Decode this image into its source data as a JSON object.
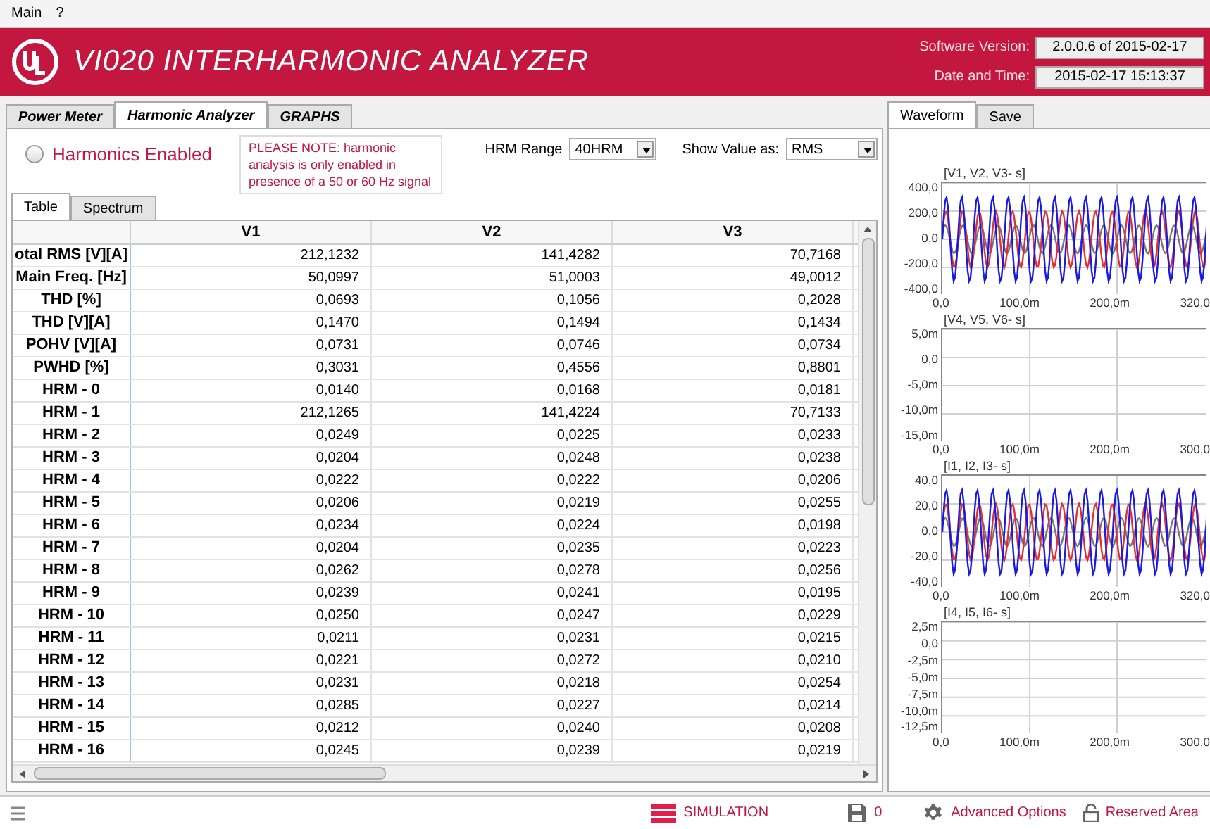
{
  "menu": [
    "Main",
    "?"
  ],
  "header": {
    "title": "VI020 INTERHARMONIC ANALYZER",
    "version_label": "Software Version:",
    "version": "2.0.0.6 of 2015-02-17",
    "datetime_label": "Date and Time:",
    "datetime": "2015-02-17 15:13:37"
  },
  "tabs": [
    {
      "label": "Power Meter",
      "selected": false
    },
    {
      "label": "Harmonic Analyzer",
      "selected": true
    },
    {
      "label": "GRAPHS",
      "selected": false
    }
  ],
  "harmonics": {
    "label": "Harmonics Enabled",
    "on": false
  },
  "note": "PLEASE NOTE: harmonic analysis is only enabled in presence of a 50 or 60 Hz signal",
  "hrm_range": {
    "label": "HRM Range",
    "value": "40HRM"
  },
  "show_value": {
    "label": "Show Value as:",
    "value": "RMS"
  },
  "subtabs": [
    {
      "label": "Table",
      "selected": true
    },
    {
      "label": "Spectrum",
      "selected": false
    }
  ],
  "table": {
    "columns": [
      "V1",
      "V2",
      "V3"
    ],
    "rows": [
      {
        "label": "otal RMS [V][A]",
        "values": [
          "212,1232",
          "141,4282",
          "70,7168"
        ]
      },
      {
        "label": "Main Freq. [Hz]",
        "values": [
          "50,0997",
          "51,0003",
          "49,0012"
        ]
      },
      {
        "label": "THD [%]",
        "values": [
          "0,0693",
          "0,1056",
          "0,2028"
        ]
      },
      {
        "label": "THD [V][A]",
        "values": [
          "0,1470",
          "0,1494",
          "0,1434"
        ]
      },
      {
        "label": "POHV [V][A]",
        "values": [
          "0,0731",
          "0,0746",
          "0,0734"
        ]
      },
      {
        "label": "PWHD [%]",
        "values": [
          "0,3031",
          "0,4556",
          "0,8801"
        ]
      },
      {
        "label": "HRM - 0",
        "values": [
          "0,0140",
          "0,0168",
          "0,0181"
        ]
      },
      {
        "label": "HRM - 1",
        "values": [
          "212,1265",
          "141,4224",
          "70,7133"
        ]
      },
      {
        "label": "HRM - 2",
        "values": [
          "0,0249",
          "0,0225",
          "0,0233"
        ]
      },
      {
        "label": "HRM - 3",
        "values": [
          "0,0204",
          "0,0248",
          "0,0238"
        ]
      },
      {
        "label": "HRM - 4",
        "values": [
          "0,0222",
          "0,0222",
          "0,0206"
        ]
      },
      {
        "label": "HRM - 5",
        "values": [
          "0,0206",
          "0,0219",
          "0,0255"
        ]
      },
      {
        "label": "HRM - 6",
        "values": [
          "0,0234",
          "0,0224",
          "0,0198"
        ]
      },
      {
        "label": "HRM - 7",
        "values": [
          "0,0204",
          "0,0235",
          "0,0223"
        ]
      },
      {
        "label": "HRM - 8",
        "values": [
          "0,0262",
          "0,0278",
          "0,0256"
        ]
      },
      {
        "label": "HRM - 9",
        "values": [
          "0,0239",
          "0,0241",
          "0,0195"
        ]
      },
      {
        "label": "HRM - 10",
        "values": [
          "0,0250",
          "0,0247",
          "0,0229"
        ]
      },
      {
        "label": "HRM - 11",
        "values": [
          "0,0211",
          "0,0231",
          "0,0215"
        ]
      },
      {
        "label": "HRM - 12",
        "values": [
          "0,0221",
          "0,0272",
          "0,0210"
        ]
      },
      {
        "label": "HRM - 13",
        "values": [
          "0,0231",
          "0,0218",
          "0,0254"
        ]
      },
      {
        "label": "HRM - 14",
        "values": [
          "0,0285",
          "0,0227",
          "0,0214"
        ]
      },
      {
        "label": "HRM - 15",
        "values": [
          "0,0212",
          "0,0240",
          "0,0208"
        ]
      },
      {
        "label": "HRM - 16",
        "values": [
          "0,0245",
          "0,0239",
          "0,0219"
        ]
      }
    ]
  },
  "right_tabs": [
    {
      "label": "Waveform",
      "selected": true
    },
    {
      "label": "Save",
      "selected": false
    }
  ],
  "charts": [
    {
      "kind": "waveform",
      "title": "[V1, V2, V3- s]",
      "yticks": [
        "400,0",
        "200,0",
        "0,0",
        "-200,0",
        "-400,0"
      ],
      "xticks": [
        "0,0",
        "100,0m",
        "200,0m",
        "320,0"
      ]
    },
    {
      "kind": "empty",
      "title": "[V4, V5, V6- s]",
      "yticks": [
        "5,0m",
        "0,0",
        "-5,0m",
        "-10,0m",
        "-15,0m"
      ],
      "xticks": [
        "0,0",
        "100,0m",
        "200,0m",
        "300,0"
      ]
    },
    {
      "kind": "waveform",
      "title": "[I1, I2, I3- s]",
      "yticks": [
        "40,0",
        "20,0",
        "0,0",
        "-20,0",
        "-40,0"
      ],
      "xticks": [
        "0,0",
        "100,0m",
        "200,0m",
        "320,0"
      ]
    },
    {
      "kind": "empty",
      "title": "[I4, I5, I6- s]",
      "yticks": [
        "2,5m",
        "0,0",
        "-2,5m",
        "-5,0m",
        "-7,5m",
        "-10,0m",
        "-12,5m"
      ],
      "xticks": [
        "0,0",
        "100,0m",
        "200,0m",
        "300,0"
      ]
    }
  ],
  "status": {
    "mode": "SIMULATION",
    "saved": "0",
    "advanced": "Advanced Options",
    "reserved": "Reserved Area"
  }
}
